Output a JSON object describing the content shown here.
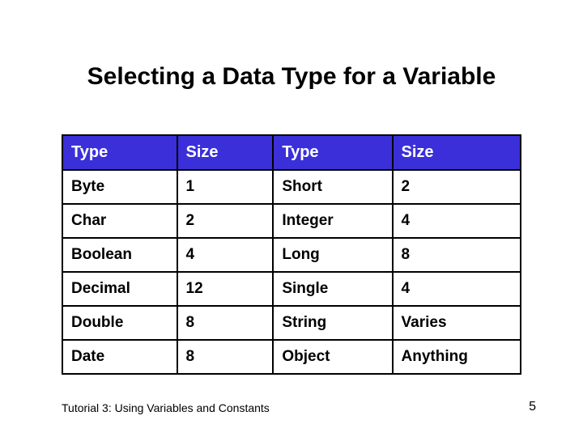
{
  "title": "Selecting a Data Type for a Variable",
  "table": {
    "headers": [
      "Type",
      "Size",
      "Type",
      "Size"
    ],
    "rows": [
      [
        "Byte",
        "1",
        "Short",
        "2"
      ],
      [
        "Char",
        "2",
        "Integer",
        "4"
      ],
      [
        "Boolean",
        "4",
        "Long",
        "8"
      ],
      [
        "Decimal",
        "12",
        "Single",
        "4"
      ],
      [
        "Double",
        "8",
        "String",
        "Varies"
      ],
      [
        "Date",
        "8",
        "Object",
        "Anything"
      ]
    ]
  },
  "footer": {
    "left": "Tutorial 3: Using Variables and Constants",
    "page": "5"
  },
  "chart_data": {
    "type": "table",
    "title": "Selecting a Data Type for a Variable",
    "columns": [
      "Type",
      "Size",
      "Type",
      "Size"
    ],
    "rows": [
      [
        "Byte",
        "1",
        "Short",
        "2"
      ],
      [
        "Char",
        "2",
        "Integer",
        "4"
      ],
      [
        "Boolean",
        "4",
        "Long",
        "8"
      ],
      [
        "Decimal",
        "12",
        "Single",
        "4"
      ],
      [
        "Double",
        "8",
        "String",
        "Varies"
      ],
      [
        "Date",
        "8",
        "Object",
        "Anything"
      ]
    ]
  }
}
